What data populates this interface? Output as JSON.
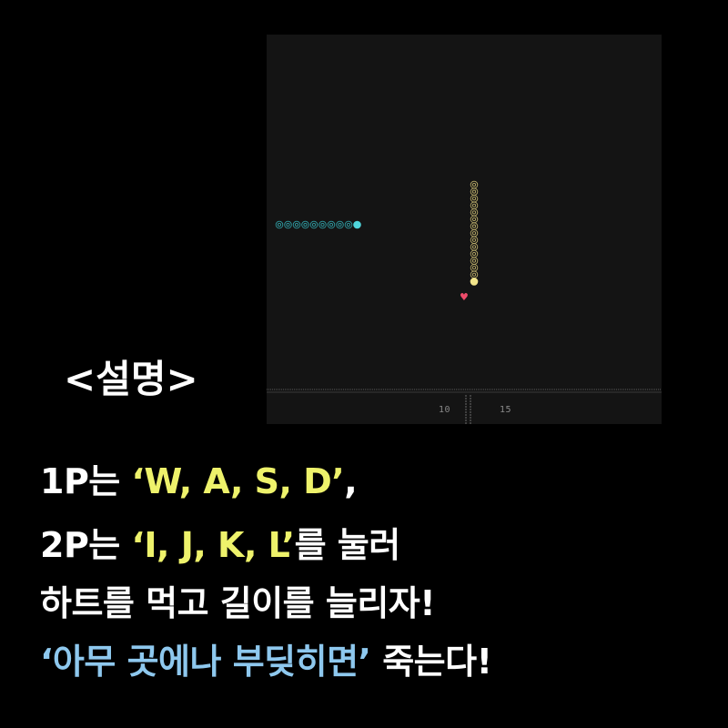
{
  "colors": {
    "background": "#000000",
    "board_background": "#141414",
    "player1_color": "#4fd6dc",
    "player2_color": "#f2e58a",
    "heart_color": "#ee4b6a",
    "highlight_yellow": "#eef26b",
    "highlight_blue": "#8ec8ee"
  },
  "game": {
    "player1_segments": 10,
    "player2_segments": 15,
    "score_p1": "10",
    "score_p2": "15",
    "heart_icon": "heart-icon"
  },
  "instructions": {
    "title": "<설명>",
    "line1": {
      "prefix": "1P는 ",
      "keys": "‘W, A, S, D’",
      "suffix": ","
    },
    "line2": {
      "prefix": "2P는 ",
      "keys": "‘I, J, K, L’",
      "suffix": "를 눌러"
    },
    "line3": "하트를 먹고 길이를 늘리자!",
    "line4": {
      "warning": "‘아무 곳에나 부딪히면’",
      "suffix": " 죽는다!"
    }
  }
}
